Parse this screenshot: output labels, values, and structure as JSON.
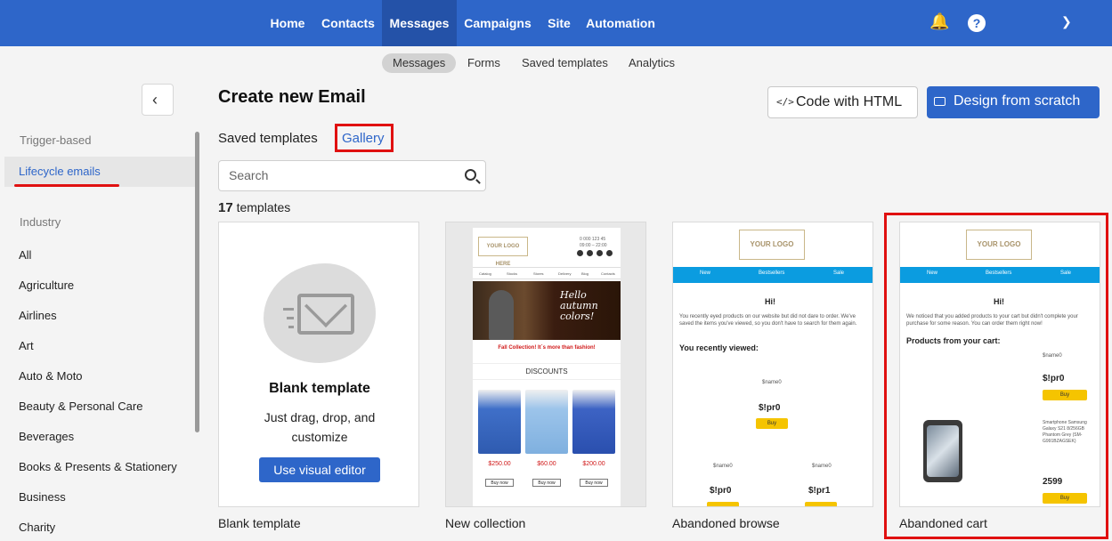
{
  "topnav": {
    "items": [
      "Home",
      "Contacts",
      "Messages",
      "Campaigns",
      "Site",
      "Automation"
    ],
    "active": "Messages"
  },
  "subnav": {
    "items": [
      "Messages",
      "Forms",
      "Saved templates",
      "Analytics"
    ],
    "active": "Messages"
  },
  "sidebar": {
    "section1": "Trigger-based",
    "active_item": "Lifecycle emails",
    "section2": "Industry",
    "industries": [
      "All",
      "Agriculture",
      "Airlines",
      "Art",
      "Auto & Moto",
      "Beauty & Personal Care",
      "Beverages",
      "Books & Presents & Stationery",
      "Business",
      "Charity"
    ]
  },
  "header": {
    "title": "Create new Email",
    "code_button": "Code with HTML",
    "design_button": "Design from scratch"
  },
  "tabs": {
    "saved": "Saved templates",
    "gallery": "Gallery"
  },
  "search": {
    "placeholder": "Search"
  },
  "count": {
    "number": "17",
    "label": "templates"
  },
  "cards": {
    "blank": {
      "heading": "Blank template",
      "sub": "Just drag, drop, and customize",
      "button": "Use visual editor",
      "title": "Blank template"
    },
    "collection": {
      "title": "New collection",
      "logo": "YOUR LOGO HERE",
      "nav": [
        "Catalog",
        "Stocks",
        "Stores",
        "Delivery",
        "Blog",
        "Contacts"
      ],
      "banner": "Hello autumn colors!",
      "sale_line": "Fall Collection! It`s more than fashion!",
      "discounts": "DISCOUNTS",
      "prices": [
        "$250.00",
        "$60.00",
        "$200.00"
      ],
      "buy": "Buy now"
    },
    "browse": {
      "title": "Abandoned browse",
      "logo": "YOUR LOGO HERE",
      "bar": [
        "New",
        "Bestsellers",
        "Sale"
      ],
      "hi": "Hi!",
      "text": "You recently eyed products on our website but did not dare to order. We've saved the items you've viewed, so you don't have to search for them again.",
      "viewed": "You recently viewed:",
      "name": "$name0",
      "price": "$!pr0",
      "price2": "$!pr1",
      "buy": "Buy"
    },
    "cart": {
      "title": "Abandoned cart",
      "logo": "YOUR LOGO HERE",
      "bar": [
        "New",
        "Bestsellers",
        "Sale"
      ],
      "hi": "Hi!",
      "text": "We noticed that you added products to your cart but didn't complete your purchase for some reason. You can order them right now!",
      "products": "Products from your cart:",
      "name": "$name0",
      "price": "$!pr0",
      "phone_desc": "Smartphone Samsung Galaxy S21 8/256GB Phantom Grey (SM-G991BZAGSEK)",
      "phone_price": "2599",
      "buy": "Buy"
    }
  }
}
